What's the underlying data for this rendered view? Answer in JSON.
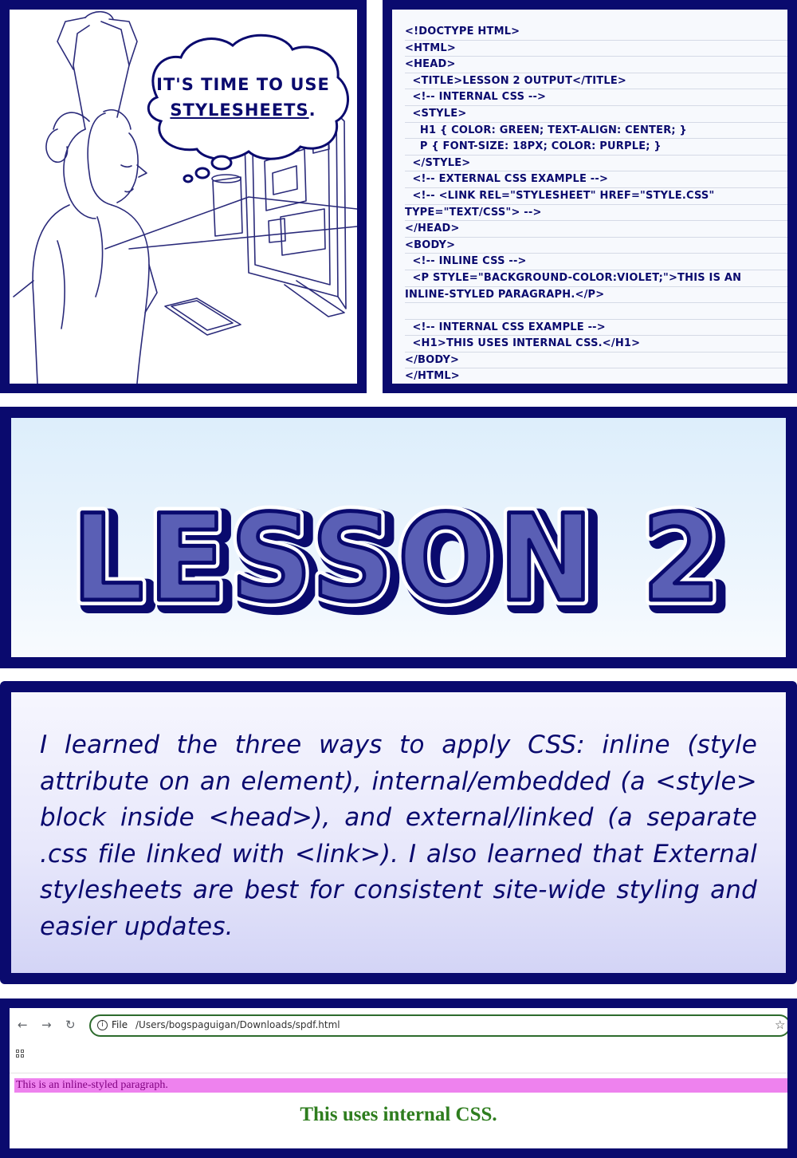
{
  "comic": {
    "bubble": {
      "line1": "IT'S TIME TO USE",
      "line2": "STYLESHEETS",
      "punct": "."
    },
    "code_lines": [
      "<!DOCTYPE html>",
      "<html>",
      "<head>",
      "  <title>Lesson 2 Output</title>",
      "  <!-- Internal CSS -->",
      "  <style>",
      "    h1 { color: green; text-align: center; }",
      "    p { font-size: 18px; color: purple; }",
      "  </style>",
      "  <!-- External CSS example -->",
      "  <!-- <link rel=\"stylesheet\" href=\"style.css\"",
      "type=\"text/css\"> -->",
      "</head>",
      "<body>",
      "  <!-- Inline CSS -->",
      "  <p style=\"background-color:violet;\">This is an",
      "inline-styled paragraph.</p>",
      "",
      "  <!-- Internal CSS example -->",
      "  <h1>This uses internal CSS.</h1>",
      "</body>",
      "</html>"
    ],
    "title": "LESSON 2",
    "summary": "I learned the three ways to apply CSS: inline (style attribute on an element), internal/embedded (a <style> block inside <head>), and external/linked (a separate .css file linked with <link>). I also learned that External stylesheets are best for consistent site-wide styling and easier updates.",
    "colors": {
      "border": "#0a0a6e",
      "title_fill": "#5a5fb5",
      "text": "#0a0a6e"
    }
  },
  "browser": {
    "back_icon": "arrow-left-icon",
    "forward_icon": "arrow-right-icon",
    "reload_icon": "reload-icon",
    "back_glyph": "←",
    "forward_glyph": "→",
    "reload_glyph": "↻",
    "info_glyph": "i",
    "file_label": "File",
    "url": "/Users/bogspaguigan/Downloads/spdf.html",
    "star_glyph": "☆",
    "paragraph": "This is an inline-styled paragraph.",
    "heading": "This uses internal CSS.",
    "colors": {
      "paragraph_bg": "#ee82ee",
      "paragraph_text": "#800080",
      "heading": "#2e7d1e"
    }
  }
}
